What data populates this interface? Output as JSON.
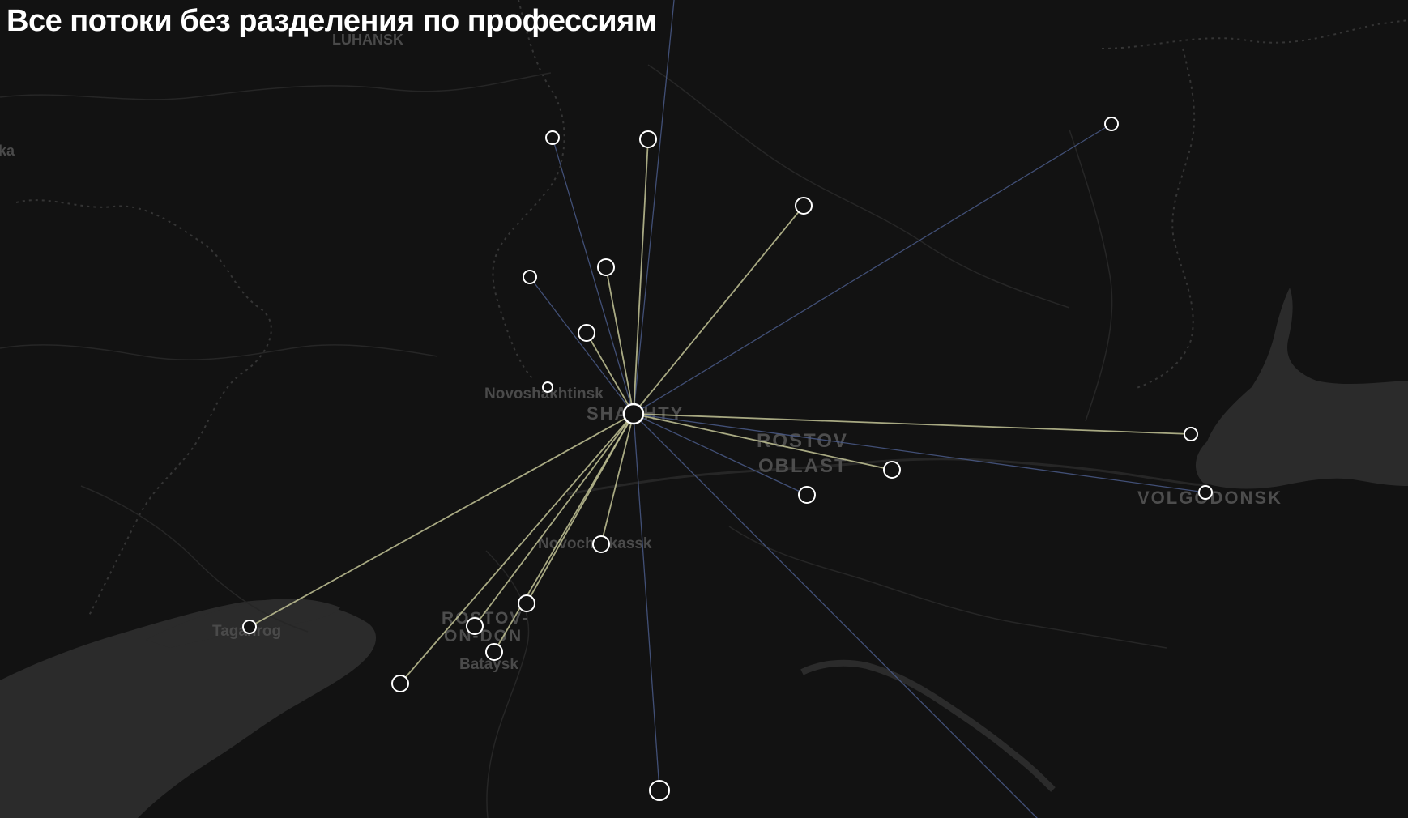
{
  "title": "Все потоки без разделения по профессиям",
  "colors": {
    "background": "#121212",
    "water": "#2b2b2b",
    "border": "#3a3a3a",
    "flow_yellow": "#b9ba8f",
    "flow_blue": "#4a5a88",
    "node": "#ffffff"
  },
  "place_labels": [
    {
      "id": "novoshakhtinsk",
      "text": "Novoshakhtinsk"
    },
    {
      "id": "shakhty",
      "text": "SHAKHTY"
    },
    {
      "id": "rostov-oblast-1",
      "text": "ROSTOV"
    },
    {
      "id": "rostov-oblast-2",
      "text": "OBLAST"
    },
    {
      "id": "volgodonsk",
      "text": "VOLGODONSK"
    },
    {
      "id": "novocherkassk",
      "text": "Novocherkassk"
    },
    {
      "id": "rostov-on-don-1",
      "text": "ROSTOV-"
    },
    {
      "id": "rostov-on-don-2",
      "text": "ON-DON"
    },
    {
      "id": "bataysk",
      "text": "Bataysk"
    },
    {
      "id": "taganrog",
      "text": "Taganrog"
    },
    {
      "id": "lugansk-partial",
      "text": "LUHANSK"
    },
    {
      "id": "west-partial",
      "text": "ka"
    }
  ],
  "hub": {
    "name": "shakhty-hub"
  },
  "flows": [
    {
      "target": "north-top",
      "color": "blue"
    },
    {
      "target": "north-a",
      "color": "yellow"
    },
    {
      "target": "north-b",
      "color": "blue"
    },
    {
      "target": "ne-1",
      "color": "yellow"
    },
    {
      "target": "ne-far",
      "color": "blue"
    },
    {
      "target": "nw-1",
      "color": "blue"
    },
    {
      "target": "nw-2",
      "color": "yellow"
    },
    {
      "target": "nw-3",
      "color": "yellow"
    },
    {
      "target": "east-1",
      "color": "yellow"
    },
    {
      "target": "east-volgodonsk",
      "color": "yellow"
    },
    {
      "target": "east-2",
      "color": "blue"
    },
    {
      "target": "east-3",
      "color": "blue"
    },
    {
      "target": "se-far",
      "color": "blue"
    },
    {
      "target": "south-1",
      "color": "blue"
    },
    {
      "target": "novocherkassk",
      "color": "yellow"
    },
    {
      "target": "rostov-1",
      "color": "yellow"
    },
    {
      "target": "rostov-2",
      "color": "yellow"
    },
    {
      "target": "bataysk",
      "color": "yellow"
    },
    {
      "target": "sw-azov",
      "color": "yellow"
    },
    {
      "target": "taganrog",
      "color": "yellow"
    }
  ]
}
